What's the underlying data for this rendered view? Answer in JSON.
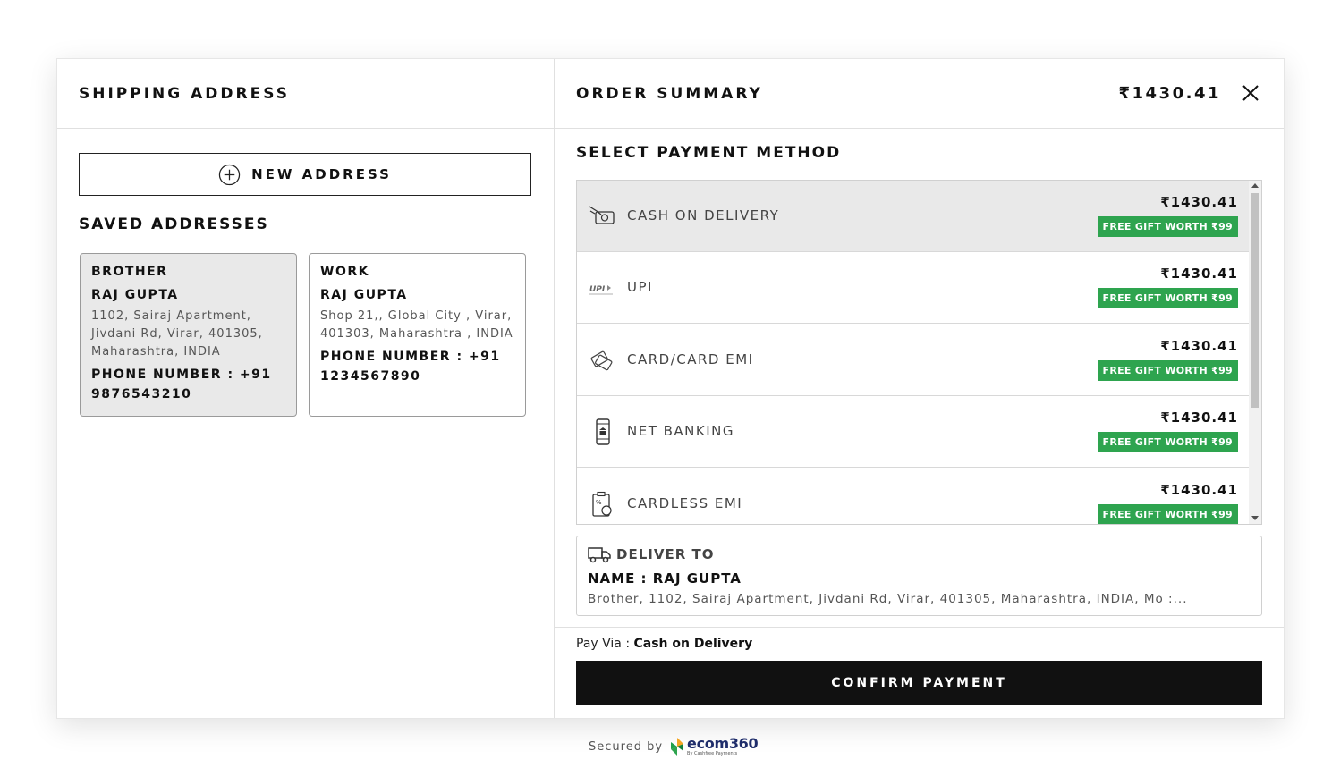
{
  "shipping": {
    "title": "SHIPPING ADDRESS",
    "new_address_label": "NEW ADDRESS",
    "saved_title": "SAVED ADDRESSES",
    "addresses": [
      {
        "type": "BROTHER",
        "name": "RAJ GUPTA",
        "address": "1102, Sairaj Apartment, Jivdani Rd, Virar, 401305, Maharashtra, INDIA",
        "phone": "PHONE NUMBER : +91 9876543210",
        "selected": true
      },
      {
        "type": "WORK",
        "name": "RAJ GUPTA",
        "address": "Shop 21,, Global City , Virar, 401303, Maharashtra , INDIA",
        "phone": "PHONE NUMBER : +91 1234567890",
        "selected": false
      }
    ]
  },
  "order": {
    "title": "ORDER SUMMARY",
    "total": "₹1430.41",
    "payment_title": "SELECT PAYMENT METHOD",
    "methods": [
      {
        "label": "CASH ON DELIVERY",
        "price": "₹1430.41",
        "gift": "FREE GIFT WORTH ₹99",
        "icon": "cash-icon",
        "selected": true
      },
      {
        "label": "UPI",
        "price": "₹1430.41",
        "gift": "FREE GIFT WORTH ₹99",
        "icon": "upi-icon",
        "selected": false
      },
      {
        "label": "CARD/CARD EMI",
        "price": "₹1430.41",
        "gift": "FREE GIFT WORTH ₹99",
        "icon": "card-icon",
        "selected": false
      },
      {
        "label": "NET BANKING",
        "price": "₹1430.41",
        "gift": "FREE GIFT WORTH ₹99",
        "icon": "bank-icon",
        "selected": false
      },
      {
        "label": "CARDLESS EMI",
        "price": "₹1430.41",
        "gift": "FREE GIFT WORTH ₹99",
        "icon": "emi-icon",
        "selected": false
      }
    ],
    "deliver": {
      "title": "DELIVER TO",
      "name": "NAME : RAJ GUPTA",
      "address": "Brother, 1102, Sairaj Apartment, Jivdani Rd, Virar, 401305, Maharashtra, INDIA, Mo :..."
    },
    "pay_via_label": "Pay Via : ",
    "pay_via_value": "Cash on Delivery",
    "confirm_label": "CONFIRM PAYMENT"
  },
  "footer": {
    "secured_label": "Secured by",
    "brand": "ecom360",
    "brand_sub": "By Cashfree Payments"
  },
  "colors": {
    "gift_badge": "#2ea44f",
    "confirm_bg": "#111111",
    "selected_bg": "#e9e9e9",
    "brand": "#1f2d6b"
  }
}
